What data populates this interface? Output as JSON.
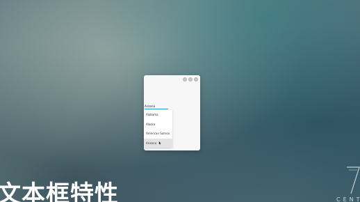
{
  "window": {
    "controls": [
      "minimize",
      "maximize",
      "close"
    ]
  },
  "search": {
    "value": "Arizona"
  },
  "suggestions": [
    {
      "label": "Alabama"
    },
    {
      "label": "Alaska"
    },
    {
      "label": "American Samoa"
    },
    {
      "label": "Arizona"
    }
  ],
  "overlay": {
    "title": "文本框特性",
    "logo_text": "CENT"
  },
  "colors": {
    "accent": "#2aa6b8",
    "window_bg": "#f7f7f7",
    "highlight": "#e3e3e3"
  },
  "icons": {
    "cursor": "arrow-cursor-icon",
    "logo": "logo-mark-icon"
  }
}
